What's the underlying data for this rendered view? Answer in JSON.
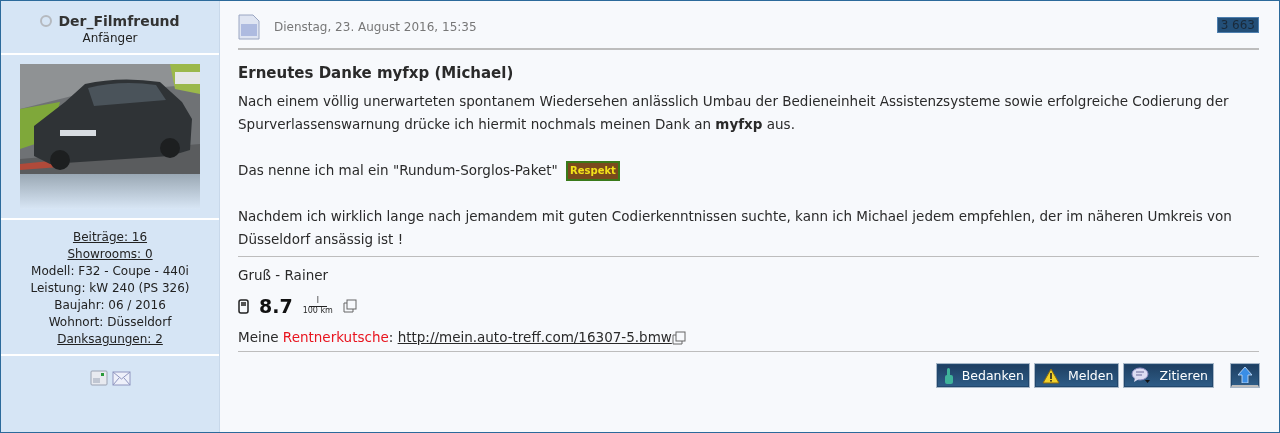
{
  "author": {
    "name": "Der_Filmfreund",
    "online": false,
    "rank": "Anfänger",
    "stats": [
      {
        "text": "Beiträge: 16",
        "link": true
      },
      {
        "text": "Showrooms: 0",
        "link": true
      },
      {
        "text": "Modell: F32 - Coupe - 440i",
        "link": false
      },
      {
        "text": "Leistung: kW 240 (PS 326)",
        "link": false
      },
      {
        "text": "Baujahr: 06 / 2016",
        "link": false
      },
      {
        "text": "Wohnort: Düsseldorf",
        "link": false
      },
      {
        "text": "Danksagungen: 2",
        "link": true
      }
    ]
  },
  "post": {
    "date": "Dienstag, 23. August 2016, 15:35",
    "number": "3 663",
    "title": "Erneutes Danke myfxp (Michael)",
    "paragraphs": [
      {
        "text": "Nach einem völlig unerwarteten spontanem Wiedersehen anlässlich Umbau der Bedieneinheit Assistenzsysteme sowie erfolgreiche Codierung der Spurverlassenswarnung drücke ich hiermit nochmals meinen Dank an **myfxp** aus."
      },
      {
        "text": "Das nenne ich mal ein \"Rundum-Sorglos-Paket\"",
        "smiley": "Respekt"
      },
      {
        "text": "Nachdem ich wirklich lange nach jemandem mit guten Codierkenntnissen suchte, kann ich Michael jedem empfehlen, der im näheren Umkreis von Düsseldorf ansässig ist !"
      }
    ],
    "signature": {
      "greeting": "Gruß - Rainer",
      "consumption": "8.7",
      "unit_top": "l",
      "unit_bottom": "100 km",
      "car_prefix": "Meine",
      "car_highlight": "Rentnerkutsche",
      "car_sep": ":",
      "url": "http://mein.auto-treff.com/16307-5.bmw"
    }
  },
  "buttons": [
    {
      "kind": "thanks",
      "label": "Bedanken"
    },
    {
      "kind": "report",
      "label": "Melden"
    },
    {
      "kind": "quote",
      "label": "Zitieren"
    },
    {
      "kind": "top"
    }
  ]
}
